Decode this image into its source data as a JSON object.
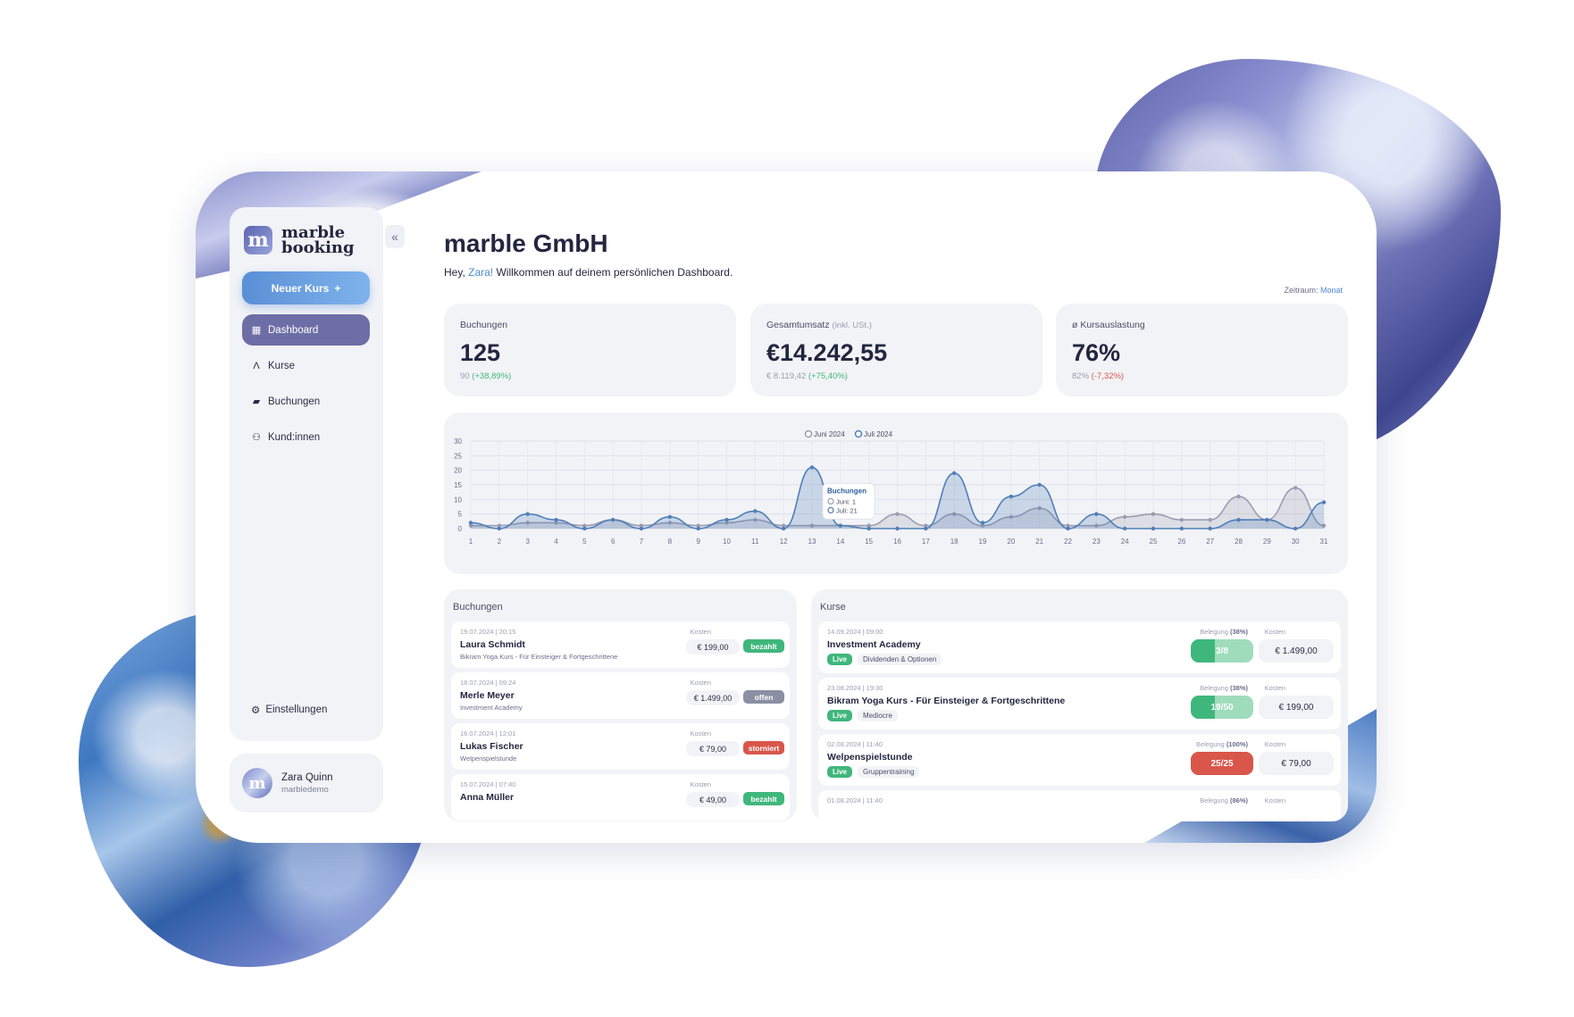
{
  "brand": {
    "line1": "marble",
    "line2": "booking",
    "mark": "m"
  },
  "sidebar": {
    "new_button": "Neuer Kurs",
    "new_button_icon": "+",
    "items": [
      {
        "label": "Dashboard",
        "icon": "dashboard-icon",
        "active": true
      },
      {
        "label": "Kurse",
        "icon": "course-icon"
      },
      {
        "label": "Buchungen",
        "icon": "folder-icon"
      },
      {
        "label": "Kund:innen",
        "icon": "customers-icon"
      }
    ],
    "settings": "Einstellungen"
  },
  "user": {
    "name": "Zara Quinn",
    "account": "marbledemo"
  },
  "header": {
    "title": "marble GmbH",
    "greeting_prefix": "Hey, ",
    "greeting_name": "Zara!",
    "greeting_suffix": " Willkommen auf deinem persönlichen Dashboard.",
    "period_label": "Zeitraum:",
    "period_value": "Monat"
  },
  "kpis": [
    {
      "label": "Buchungen",
      "label_note": "",
      "value": "125",
      "prev": "90",
      "change": "(+38,89%)",
      "trend": "up"
    },
    {
      "label": "Gesamtumsatz",
      "label_note": "(inkl. USt.)",
      "value": "€14.242,55",
      "prev": "€ 8.119,42",
      "change": "(+75,40%)",
      "trend": "up"
    },
    {
      "label": "ø Kursauslastung",
      "label_note": "",
      "value": "76%",
      "prev": "82%",
      "change": "(-7,32%)",
      "trend": "down"
    }
  ],
  "chart_data": {
    "type": "area",
    "x": [
      1,
      2,
      3,
      4,
      5,
      6,
      7,
      8,
      9,
      10,
      11,
      12,
      13,
      14,
      15,
      16,
      17,
      18,
      19,
      20,
      21,
      22,
      23,
      24,
      25,
      26,
      27,
      28,
      29,
      30,
      31
    ],
    "ylim": [
      0,
      30
    ],
    "yticks": [
      0,
      5,
      10,
      15,
      20,
      25,
      30
    ],
    "grid": true,
    "legend_position": "top-center",
    "series": [
      {
        "name": "Juni 2024",
        "color": "#9a9cb0",
        "values": [
          1,
          1,
          2,
          2,
          1,
          3,
          1,
          2,
          1,
          2,
          3,
          1,
          1,
          1,
          1,
          5,
          1,
          5,
          1,
          4,
          7,
          1,
          1,
          4,
          5,
          3,
          3,
          11,
          3,
          14,
          1
        ]
      },
      {
        "name": "Juli 2024",
        "color": "#4f7fb8",
        "values": [
          2,
          0,
          5,
          3,
          0,
          3,
          0,
          4,
          0,
          3,
          6,
          0,
          21,
          1,
          0,
          0,
          0,
          19,
          2,
          11,
          15,
          0,
          5,
          0,
          0,
          0,
          0,
          3,
          3,
          0,
          9
        ]
      }
    ],
    "tooltip": {
      "title": "Buchungen",
      "lines": [
        "Juni: 1",
        "Juli: 21"
      ],
      "x": 13
    }
  },
  "bookings_panel": {
    "title": "Buchungen",
    "cost_label": "Kosten",
    "rows": [
      {
        "date": "19.07.2024 | 20:15",
        "name": "Laura Schmidt",
        "course": "Bikram Yoga Kurs - Für Einsteiger & Fortgeschrittene",
        "cost": "€ 199,00",
        "status": "bezahlt",
        "status_type": "paid"
      },
      {
        "date": "18.07.2024 | 09:24",
        "name": "Merle Meyer",
        "course": "Investment Academy",
        "cost": "€ 1.499,00",
        "status": "offen",
        "status_type": "open"
      },
      {
        "date": "16.07.2024 | 12:01",
        "name": "Lukas Fischer",
        "course": "Welpenspielstunde",
        "cost": "€ 79,00",
        "status": "storniert",
        "status_type": "cancel"
      },
      {
        "date": "15.07.2024 | 07:40",
        "name": "Anna Müller",
        "course": "",
        "cost": "€ 49,00",
        "status": "bezahlt",
        "status_type": "paid"
      }
    ]
  },
  "courses_panel": {
    "title": "Kurse",
    "occupancy_label": "Belegung",
    "cost_label": "Kosten",
    "rows": [
      {
        "date": "14.09.2024 | 09:00",
        "name": "Investment Academy",
        "tag_live": "Live",
        "tag": "Dividenden & Optionen",
        "occ_pct": "(38%)",
        "occ": "3/8",
        "occ_fraction": 0.38,
        "occ_color": "#3fb77c",
        "cost": "€ 1.499,00"
      },
      {
        "date": "23.08.2024 | 19:30",
        "name": "Bikram Yoga Kurs - Für Einsteiger & Fortgeschrittene",
        "tag_live": "Live",
        "tag": "Mediocre",
        "occ_pct": "(38%)",
        "occ": "19/50",
        "occ_fraction": 0.38,
        "occ_color": "#3fb77c",
        "cost": "€ 199,00"
      },
      {
        "date": "02.08.2024 | 11:40",
        "name": "Welpenspielstunde",
        "tag_live": "Live",
        "tag": "Gruppentraining",
        "occ_pct": "(100%)",
        "occ": "25/25",
        "occ_fraction": 1.0,
        "occ_color": "#d9564a",
        "cost": "€ 79,00"
      },
      {
        "date": "01.08.2024 | 11:40",
        "name": "",
        "tag_live": "",
        "tag": "",
        "occ_pct": "(86%)",
        "occ": "",
        "occ_fraction": 0.86,
        "occ_color": "#3fb77c",
        "cost": ""
      }
    ]
  }
}
